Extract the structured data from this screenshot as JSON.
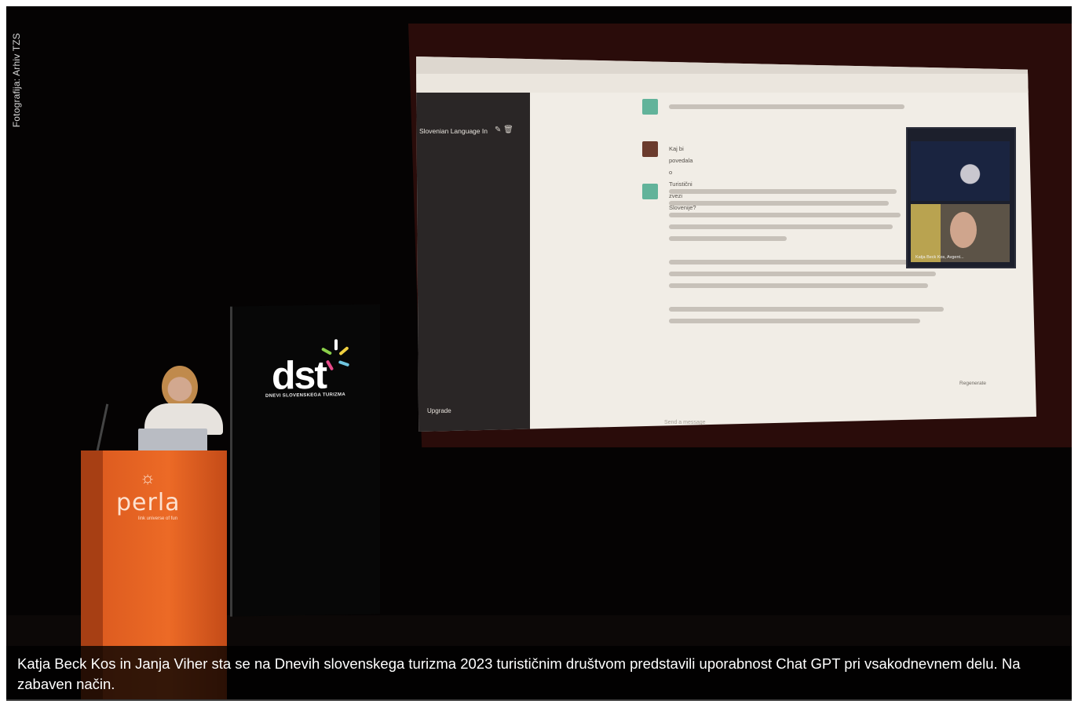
{
  "photo_credit": "Fotografija: Arhiv TZS",
  "caption": "Katja Beck Kos in Janja Viher sta se na Dnevih slovenskega turizma 2023 turističnim društvom predstavili uporabnost Chat GPT pri vsakodnevnem delu. Na zabaven način.",
  "screen": {
    "sidebar_chat": "Slovenian Language In",
    "sidebar_upgrade": "Upgrade",
    "question": "Kaj bi povedala o Turistični zvezi Slovenije?",
    "regenerate": "Regenerate",
    "send_placeholder": "Send a message",
    "video_label_bottom": "Katja Beck Kos, Avgent..."
  },
  "banner": {
    "logo": "dst",
    "subtitle": "DNEVI SLOVENSKEGA TURIZMA"
  },
  "lectern": {
    "logo": "perla",
    "subtitle": "link universe of fun"
  },
  "colors": {
    "lectern": "#ec6a26",
    "screen": "#f1ede6",
    "background": "#050303"
  }
}
